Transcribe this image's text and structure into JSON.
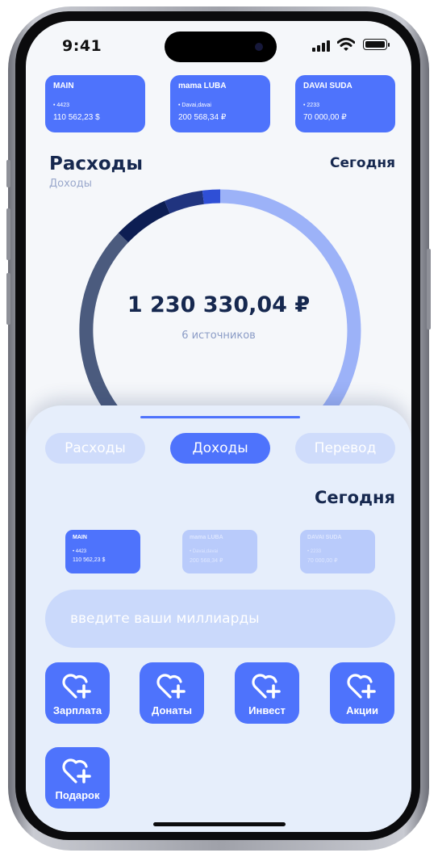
{
  "status_bar": {
    "time": "9:41",
    "icons": [
      "signal-icon",
      "wifi-icon",
      "battery-icon"
    ]
  },
  "accounts": [
    {
      "name": "MAIN",
      "number": "4423",
      "balance": "110 562,23 $"
    },
    {
      "name": "mama LUBA",
      "number": "Davai,davai",
      "balance": "200 568,34 ₽"
    },
    {
      "name": "DAVAI SUDA",
      "number": "2233",
      "balance": "70 000,00 ₽"
    }
  ],
  "summary": {
    "title": "Расходы",
    "subtitle": "Доходы",
    "period": "Сегодня",
    "total": "1 230 330,04 ₽",
    "sources": "6 источников",
    "segment_colors": [
      "#9cb2f8",
      "#4b5b7e",
      "#0d1e53",
      "#20347f",
      "#2f4fd6"
    ]
  },
  "sheet": {
    "tabs": [
      {
        "label": "Расходы",
        "active": false
      },
      {
        "label": "Доходы",
        "active": true
      },
      {
        "label": "Перевод",
        "active": false
      }
    ],
    "period": "Сегодня",
    "amount_placeholder": "введите ваши миллиарды",
    "categories": [
      {
        "label": "Зарплата",
        "icon": "heart-plus-icon"
      },
      {
        "label": "Донаты",
        "icon": "heart-plus-icon"
      },
      {
        "label": "Инвест",
        "icon": "heart-plus-icon"
      },
      {
        "label": "Акции",
        "icon": "heart-plus-icon"
      },
      {
        "label": "Подарок",
        "icon": "heart-plus-icon"
      }
    ]
  },
  "colors": {
    "accent": "#4e73fc",
    "dark_text": "#16284f",
    "sheet_bg": "#e6eefb"
  }
}
